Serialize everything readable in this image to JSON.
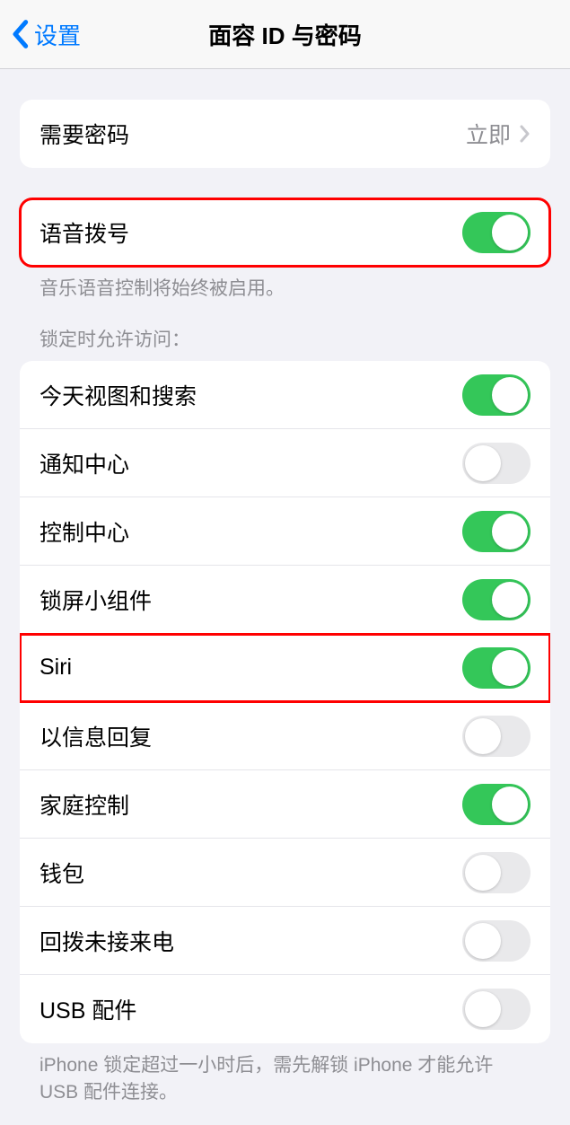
{
  "nav": {
    "back_label": "设置",
    "title": "面容 ID 与密码"
  },
  "require_passcode": {
    "label": "需要密码",
    "value": "立即"
  },
  "voice_dial": {
    "label": "语音拨号",
    "enabled": true,
    "footer": "音乐语音控制将始终被启用。"
  },
  "lock_access": {
    "header": "锁定时允许访问：",
    "items": [
      {
        "label": "今天视图和搜索",
        "enabled": true
      },
      {
        "label": "通知中心",
        "enabled": false
      },
      {
        "label": "控制中心",
        "enabled": true
      },
      {
        "label": "锁屏小组件",
        "enabled": true
      },
      {
        "label": "Siri",
        "enabled": true,
        "highlight": true
      },
      {
        "label": "以信息回复",
        "enabled": false
      },
      {
        "label": "家庭控制",
        "enabled": true
      },
      {
        "label": "钱包",
        "enabled": false
      },
      {
        "label": "回拨未接来电",
        "enabled": false
      },
      {
        "label": "USB 配件",
        "enabled": false
      }
    ],
    "footer": "iPhone 锁定超过一小时后，需先解锁 iPhone 才能允许 USB 配件连接。"
  }
}
